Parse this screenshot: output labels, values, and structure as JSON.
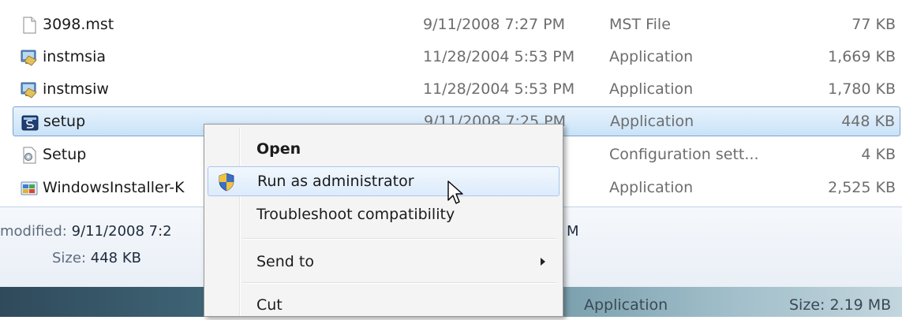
{
  "files": [
    {
      "name": "3098.mst",
      "modified": "9/11/2008 7:27 PM",
      "type": "MST File",
      "size": "77 KB",
      "icon": "document-icon"
    },
    {
      "name": "instmsia",
      "modified": "11/28/2004 5:53 PM",
      "type": "Application",
      "size": "1,669 KB",
      "icon": "installer-app-icon"
    },
    {
      "name": "instmsiw",
      "modified": "11/28/2004 5:53 PM",
      "type": "Application",
      "size": "1,780 KB",
      "icon": "installer-app-icon"
    },
    {
      "name": "setup",
      "modified": "9/11/2008 7:25 PM",
      "type": "Application",
      "size": "448 KB",
      "icon": "setup-app-icon"
    },
    {
      "name": "Setup",
      "modified": "",
      "type": "Configuration sett...",
      "size": "4 KB",
      "icon": "config-settings-icon"
    },
    {
      "name": "WindowsInstaller-K",
      "modified": "",
      "type": "Application",
      "size": "2,525 KB",
      "icon": "windows-installer-icon"
    }
  ],
  "details": {
    "modified_label": "modified:",
    "modified_value": "9/11/2008 7:2",
    "modified_tail": "M",
    "size_label": "Size:",
    "size_value": "448 KB"
  },
  "bottom_strip": {
    "type": "Application",
    "size": "Size: 2.19 MB"
  },
  "context_menu": {
    "items": [
      {
        "label": "Open",
        "bold": true
      },
      {
        "label": "Run as administrator",
        "icon": "uac-shield-icon",
        "hover": true
      },
      {
        "label": "Troubleshoot compatibility"
      },
      {
        "label": "Send to",
        "submenu": true
      },
      {
        "label": "Cut"
      }
    ]
  },
  "colors": {
    "selection_border": "#7da2ce",
    "hover_border": "#a8c8ec",
    "secondary_text": "#6d6d6d"
  }
}
